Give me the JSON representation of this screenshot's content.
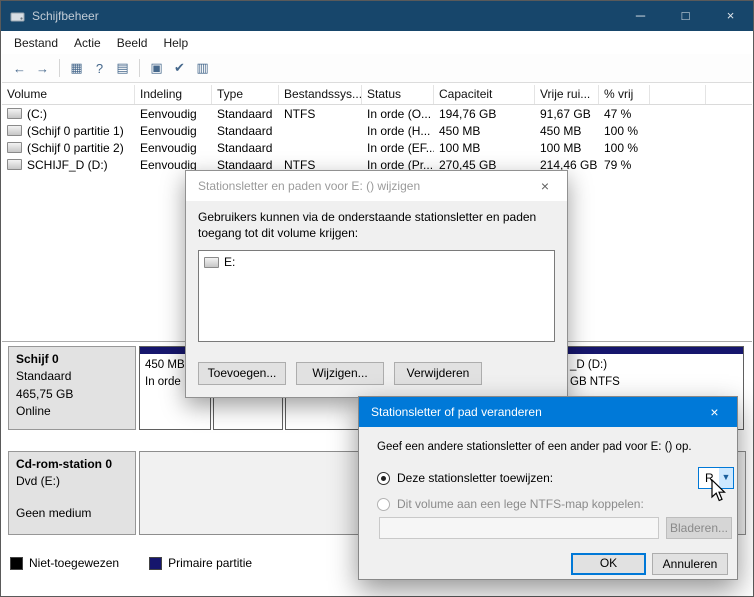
{
  "window": {
    "title": "Schijfbeheer",
    "controls": {
      "minimize": "─",
      "maximize": "□",
      "close": "×"
    },
    "menu": [
      "Bestand",
      "Actie",
      "Beeld",
      "Help"
    ]
  },
  "toolbar": [
    {
      "name": "back",
      "glyph": "←"
    },
    {
      "name": "forward",
      "glyph": "→"
    },
    {
      "name": "console-tree",
      "glyph": "▦"
    },
    {
      "name": "help",
      "glyph": "?"
    },
    {
      "name": "list-view",
      "glyph": "▤"
    },
    {
      "name": "action",
      "glyph": "▣"
    },
    {
      "name": "check-disk",
      "glyph": "✔"
    },
    {
      "name": "properties",
      "glyph": "▥"
    }
  ],
  "table": {
    "columns": [
      "Volume",
      "Indeling",
      "Type",
      "Bestandssys...",
      "Status",
      "Capaciteit",
      "Vrije rui...",
      "% vrij"
    ],
    "rows": [
      {
        "volume": "(C:)",
        "indeling": "Eenvoudig",
        "type": "Standaard",
        "fs": "NTFS",
        "status": "In orde (O...",
        "capaciteit": "194,76 GB",
        "vrij": "91,67 GB",
        "pct": "47 %"
      },
      {
        "volume": "(Schijf 0 partitie 1)",
        "indeling": "Eenvoudig",
        "type": "Standaard",
        "fs": "",
        "status": "In orde (H...",
        "capaciteit": "450 MB",
        "vrij": "450 MB",
        "pct": "100 %"
      },
      {
        "volume": "(Schijf 0 partitie 2)",
        "indeling": "Eenvoudig",
        "type": "Standaard",
        "fs": "",
        "status": "In orde (EF...",
        "capaciteit": "100 MB",
        "vrij": "100 MB",
        "pct": "100 %"
      },
      {
        "volume": "SCHIJF_D (D:)",
        "indeling": "Eenvoudig",
        "type": "Standaard",
        "fs": "NTFS",
        "status": "In orde (Pr...",
        "capaciteit": "270,45 GB",
        "vrij": "214,46 GB",
        "pct": "79 %"
      }
    ]
  },
  "graph": {
    "disk0": {
      "name": "Schijf 0",
      "kind": "Standaard",
      "size": "465,75 GB",
      "status": "Online",
      "part1": {
        "size": "450 MB",
        "status": "In orde"
      },
      "part4": {
        "label": "_D  (D:)",
        "info": "GB NTFS"
      }
    },
    "cdrom": {
      "name": "Cd-rom-station 0",
      "kind": "Dvd (E:)",
      "status": "Geen medium"
    }
  },
  "legend": {
    "unallocated": {
      "label": "Niet-toegewezen",
      "color": "#000000"
    },
    "primary": {
      "label": "Primaire partitie",
      "color": "#16166d"
    }
  },
  "dialog_paths": {
    "title": "Stationsletter en paden voor E: () wijzigen",
    "close": "×",
    "description": "Gebruikers kunnen via de onderstaande stationsletter en paden toegang tot dit volume krijgen:",
    "list_item": "E:",
    "buttons": {
      "add": "Toevoegen...",
      "change": "Wijzigen...",
      "remove": "Verwijderen"
    }
  },
  "dialog_change": {
    "title": "Stationsletter of pad veranderen",
    "close": "×",
    "description": "Geef een andere stationsletter of een ander pad voor E: () op.",
    "radio_assign": "Deze stationsletter toewijzen:",
    "radio_mount": "Dit volume aan een lege NTFS-map koppelen:",
    "drive_letter": "R",
    "chevron": "▼",
    "browse": "Bladeren...",
    "ok": "OK",
    "cancel": "Annuleren"
  },
  "colors": {
    "accent": "#0078d7",
    "titlebar": "#17466b",
    "primary_partition": "#16166d"
  }
}
